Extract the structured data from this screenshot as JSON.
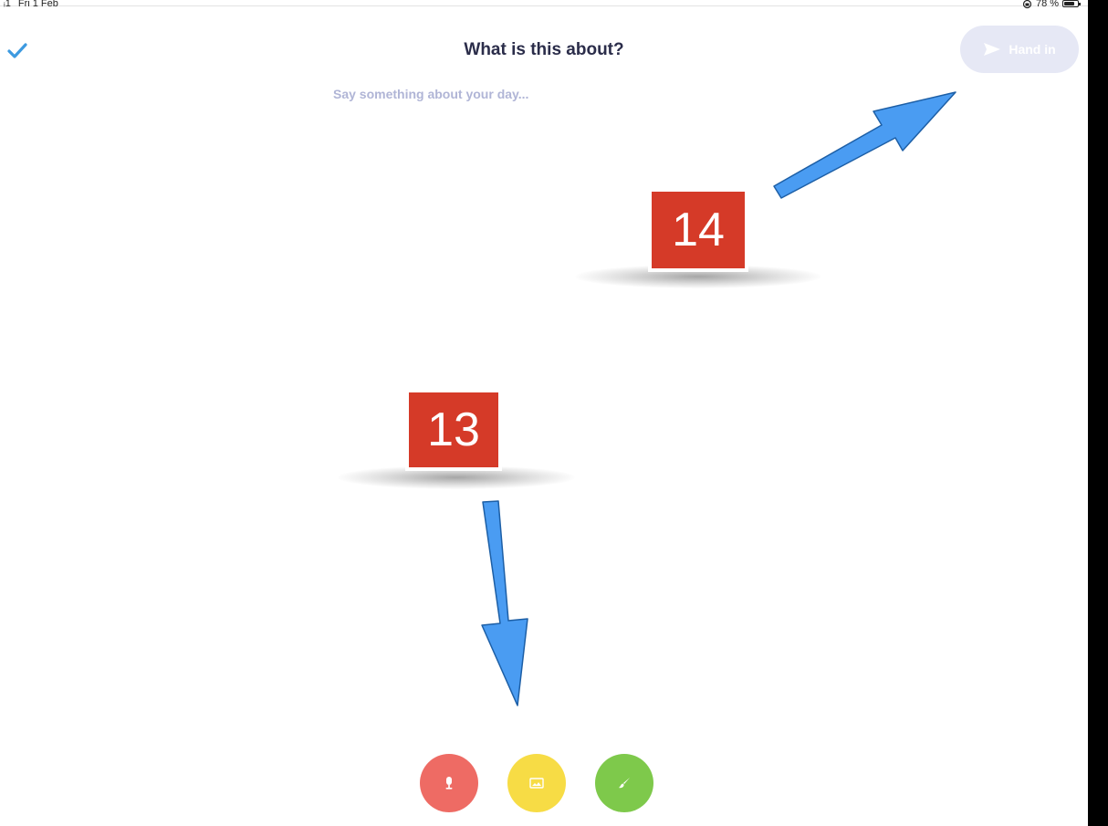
{
  "status_bar": {
    "signal": "ᵢ1",
    "date": "Fri 1 Feb",
    "battery_percent": "78 %",
    "battery_level": 0.78
  },
  "header": {
    "title": "What is this about?",
    "hand_in_label": "Hand in",
    "hand_in_enabled": false
  },
  "editor": {
    "placeholder": "Say something about your day...",
    "value": ""
  },
  "annotations": [
    {
      "number": "14",
      "points_to": "hand-in-button"
    },
    {
      "number": "13",
      "points_to": "toolbar"
    }
  ],
  "toolbar": {
    "items": [
      {
        "name": "microphone",
        "icon": "microphone-icon",
        "color": "#ee6b64"
      },
      {
        "name": "image",
        "icon": "image-icon",
        "color": "#f7dc45"
      },
      {
        "name": "draw",
        "icon": "paintbrush-icon",
        "color": "#7ec94b"
      }
    ]
  },
  "colors": {
    "accent_check": "#3d9ae0",
    "title": "#2b2d4a",
    "badge": "#d53a28",
    "arrow": "#4a9cf2",
    "hand_in_bg": "#e6e8f5",
    "placeholder": "#b0b5d6"
  }
}
